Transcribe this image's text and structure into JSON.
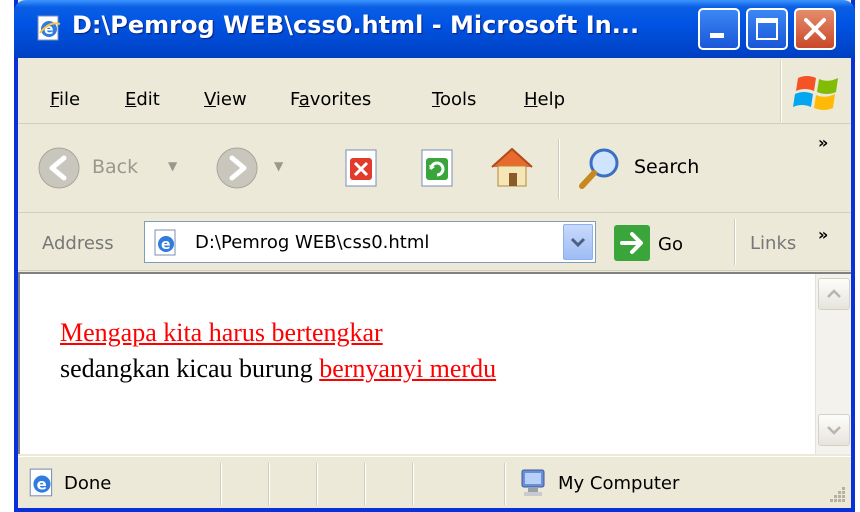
{
  "window": {
    "title": "D:\\Pemrog WEB\\css0.html - Microsoft In...",
    "title_icon": "ie-page-icon",
    "controls": [
      "minimize-icon",
      "maximize-icon",
      "close-icon"
    ]
  },
  "menu": {
    "items": [
      {
        "label": "File",
        "underline": "F"
      },
      {
        "label": "Edit",
        "underline": "E"
      },
      {
        "label": "View",
        "underline": "V"
      },
      {
        "label": "Favorites",
        "underline": "a"
      },
      {
        "label": "Tools",
        "underline": "T"
      },
      {
        "label": "Help",
        "underline": "H"
      }
    ],
    "logo_icon": "windows-flag-icon"
  },
  "toolbar": {
    "back_label": "Back",
    "search_label": "Search",
    "overflow": "»",
    "icons": [
      "back-arrow-icon",
      "forward-arrow-icon",
      "stop-icon",
      "refresh-icon",
      "home-icon",
      "search-icon"
    ]
  },
  "address": {
    "label": "Address",
    "value": "D:\\Pemrog WEB\\css0.html",
    "go_label": "Go",
    "links_label": "Links",
    "overflow": "»"
  },
  "page": {
    "line1_link": "Mengapa kita harus bertengkar",
    "line2_text": "sedangkan kicau burung ",
    "line2_link": "bernyanyi merdu",
    "link_color": "#ff0000"
  },
  "status": {
    "left_text": "Done",
    "zone_text": "My Computer"
  },
  "colors": {
    "titlebar": "#0054e3",
    "frame": "#0831d9",
    "chrome": "#ece9d8"
  }
}
